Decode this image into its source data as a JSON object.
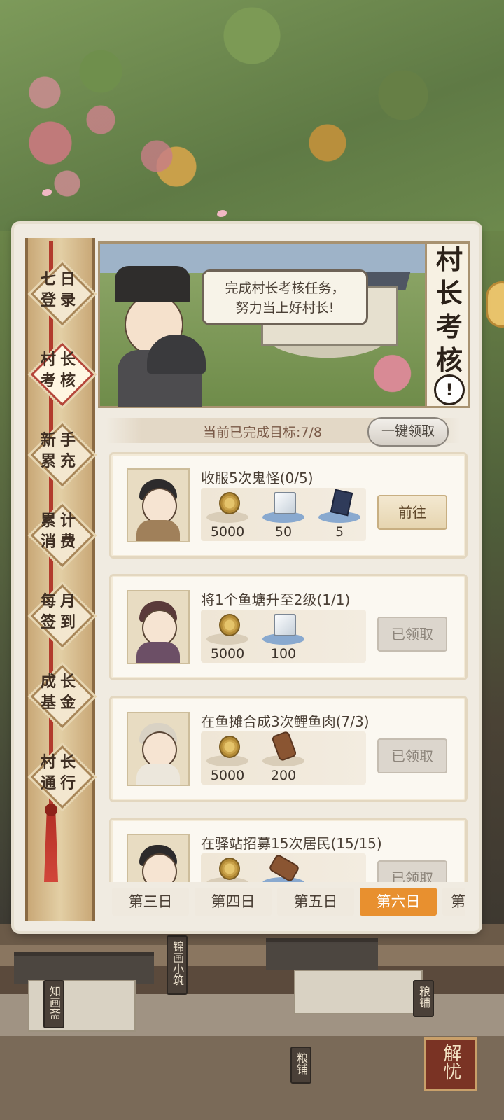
{
  "sidebar": {
    "items": [
      {
        "line1": "七日",
        "line2": "登录",
        "active": false
      },
      {
        "line1": "村长",
        "line2": "考核",
        "active": true
      },
      {
        "line1": "新手",
        "line2": "累充",
        "active": false
      },
      {
        "line1": "累计",
        "line2": "消费",
        "active": false
      },
      {
        "line1": "每月",
        "line2": "签到",
        "active": false
      },
      {
        "line1": "成长",
        "line2": "基金",
        "active": false
      },
      {
        "line1": "村长",
        "line2": "通行",
        "active": false
      }
    ]
  },
  "banner": {
    "speech_line1": "完成村长考核任务，",
    "speech_line2": "努力当上好村长!",
    "title_chars": [
      "村",
      "长",
      "考",
      "核"
    ],
    "alert_symbol": "!"
  },
  "progress": {
    "text": "当前已完成目标:7/8",
    "completed": 7,
    "total": 8,
    "claim_all_label": "一键领取"
  },
  "tasks": [
    {
      "title": "收服5次鬼怪(0/5)",
      "rewards": [
        {
          "icon": "coin-icon",
          "qty": "5000"
        },
        {
          "icon": "block-icon",
          "qty": "50"
        },
        {
          "icon": "book-icon",
          "qty": "5"
        }
      ],
      "action": "前往",
      "state": "go"
    },
    {
      "title": "将1个鱼塘升至2级(1/1)",
      "rewards": [
        {
          "icon": "coin-icon",
          "qty": "5000"
        },
        {
          "icon": "block-icon",
          "qty": "100"
        }
      ],
      "action": "已领取",
      "state": "done"
    },
    {
      "title": "在鱼摊合成3次鲤鱼肉(7/3)",
      "rewards": [
        {
          "icon": "coin-icon",
          "qty": "5000"
        },
        {
          "icon": "wood-icon",
          "qty": "200"
        }
      ],
      "action": "已领取",
      "state": "done"
    },
    {
      "title": "在驿站招募15次居民(15/15)",
      "rewards": [
        {
          "icon": "coin-icon",
          "qty": ""
        },
        {
          "icon": "wood-icon",
          "qty": ""
        }
      ],
      "action": "已领取",
      "state": "done"
    }
  ],
  "day_tabs": [
    {
      "label": "第三日",
      "active": false
    },
    {
      "label": "第四日",
      "active": false
    },
    {
      "label": "第五日",
      "active": false
    },
    {
      "label": "第六日",
      "active": true
    },
    {
      "label": "第",
      "active": false
    }
  ],
  "scene_signs": {
    "jinhua": "锦画小筑",
    "zhihua": "知画斋",
    "liangpu_right": "粮铺",
    "liangpu_bottom": "粮铺",
    "jieyou": "解忧"
  },
  "colors": {
    "accent_tab": "#e8902f",
    "rope_red": "#b23b2d",
    "panel_bg": "#f0ebe1"
  }
}
